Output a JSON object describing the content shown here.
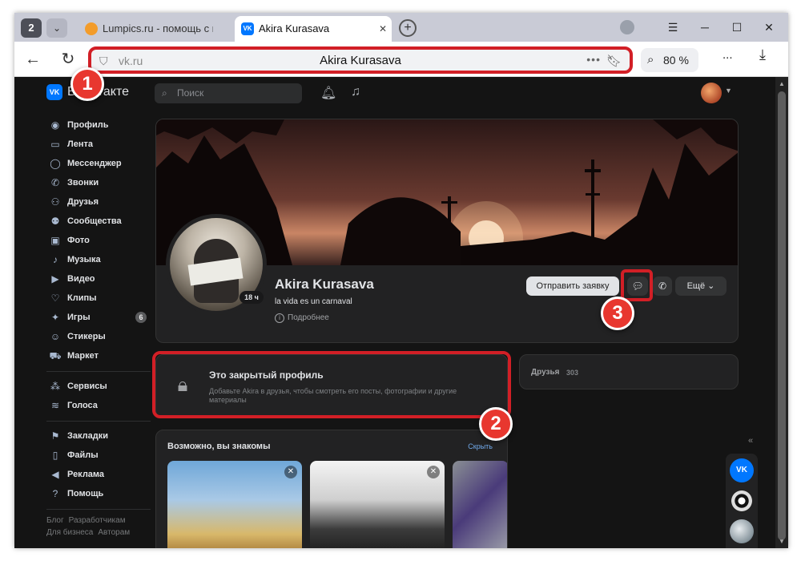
{
  "browser": {
    "tab_count": "2",
    "tabs": [
      {
        "label": "Lumpics.ru - помощь с ко",
        "active": false
      },
      {
        "label": "Akira Kurasava",
        "active": true
      }
    ],
    "address": {
      "domain": "vk.ru",
      "page_title": "Akira Kurasava"
    },
    "zoom": "80 %",
    "more_label": "..."
  },
  "vk": {
    "logo_text": "ВКонтакте",
    "search_placeholder": "Поиск",
    "sidebar": {
      "items": [
        {
          "label": "Профиль",
          "icon": "profile-icon"
        },
        {
          "label": "Лента",
          "icon": "feed-icon"
        },
        {
          "label": "Мессенджер",
          "icon": "messenger-icon"
        },
        {
          "label": "Звонки",
          "icon": "phone-icon"
        },
        {
          "label": "Друзья",
          "icon": "friends-icon"
        },
        {
          "label": "Сообщества",
          "icon": "communities-icon"
        },
        {
          "label": "Фото",
          "icon": "photo-icon"
        },
        {
          "label": "Музыка",
          "icon": "music-icon"
        },
        {
          "label": "Видео",
          "icon": "video-icon"
        },
        {
          "label": "Клипы",
          "icon": "clips-icon"
        },
        {
          "label": "Игры",
          "icon": "games-icon",
          "badge": "6"
        },
        {
          "label": "Стикеры",
          "icon": "stickers-icon"
        },
        {
          "label": "Маркет",
          "icon": "market-icon"
        }
      ],
      "services": [
        {
          "label": "Сервисы",
          "icon": "services-icon"
        },
        {
          "label": "Голоса",
          "icon": "votes-icon"
        }
      ],
      "extra": [
        {
          "label": "Закладки",
          "icon": "bookmarks-icon"
        },
        {
          "label": "Файлы",
          "icon": "files-icon"
        },
        {
          "label": "Реклама",
          "icon": "ads-icon"
        },
        {
          "label": "Помощь",
          "icon": "help-icon"
        }
      ],
      "footer": {
        "row1": [
          "Блог",
          "Разработчикам"
        ],
        "row2": [
          "Для бизнеса",
          "Авторам"
        ]
      }
    },
    "profile": {
      "name": "Akira Kurasava",
      "status": "la vida es un carnaval",
      "details_link": "Подробнее",
      "online": "18 ч",
      "btn_request": "Отправить заявку",
      "btn_more": "Ещё"
    },
    "closed_profile": {
      "title": "Это закрытый профиль",
      "description": "Добавьте Akira в друзья, чтобы смотреть его посты, фотографии и другие материалы"
    },
    "friends": {
      "label": "Друзья",
      "count": "303"
    },
    "suggestions": {
      "title": "Возможно, вы знакомы",
      "hide": "Скрыть"
    }
  },
  "markers": [
    "1",
    "2",
    "3"
  ],
  "colors": {
    "accent": "#0077ff",
    "highlight": "#d21f26",
    "marker": "#e8372f",
    "link": "#71aaeb"
  }
}
